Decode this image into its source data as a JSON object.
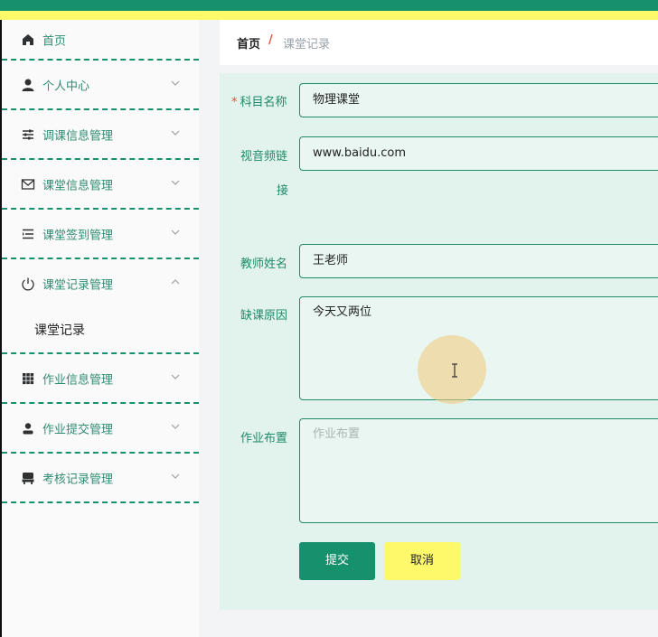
{
  "colors": {
    "primary": "#16916d",
    "accent": "#fdf96b",
    "required": "#e8503c",
    "panel": "#e2f2ec"
  },
  "sidebar": {
    "items": [
      {
        "label": "首页",
        "icon": "home-icon"
      },
      {
        "label": "个人中心",
        "icon": "person-icon",
        "chevron": "down"
      },
      {
        "label": "调课信息管理",
        "icon": "sliders-icon",
        "chevron": "down"
      },
      {
        "label": "课堂信息管理",
        "icon": "mail-icon",
        "chevron": "down"
      },
      {
        "label": "课堂签到管理",
        "icon": "list-icon",
        "chevron": "down"
      },
      {
        "label": "课堂记录管理",
        "icon": "power-icon",
        "chevron": "up",
        "expanded": true
      },
      {
        "label": "作业信息管理",
        "icon": "grid-icon",
        "chevron": "down"
      },
      {
        "label": "作业提交管理",
        "icon": "user-icon",
        "chevron": "down"
      },
      {
        "label": "考核记录管理",
        "icon": "chair-icon",
        "chevron": "down"
      }
    ],
    "sub_item": "课堂记录"
  },
  "breadcrumb": {
    "home": "首页",
    "separator": "/",
    "current": "课堂记录"
  },
  "form": {
    "subject": {
      "required_mark": "*",
      "label": "科目名称",
      "value": "物理课堂"
    },
    "video_link": {
      "label_line1": "视音频链",
      "label_line2": "接",
      "value": "www.baidu.com"
    },
    "teacher": {
      "label": "教师姓名",
      "value": "王老师"
    },
    "absence_reason": {
      "label": "缺课原因",
      "value": "今天又两位"
    },
    "homework": {
      "label": "作业布置",
      "placeholder": "作业布置"
    },
    "submit_label": "提交",
    "cancel_label": "取消"
  }
}
